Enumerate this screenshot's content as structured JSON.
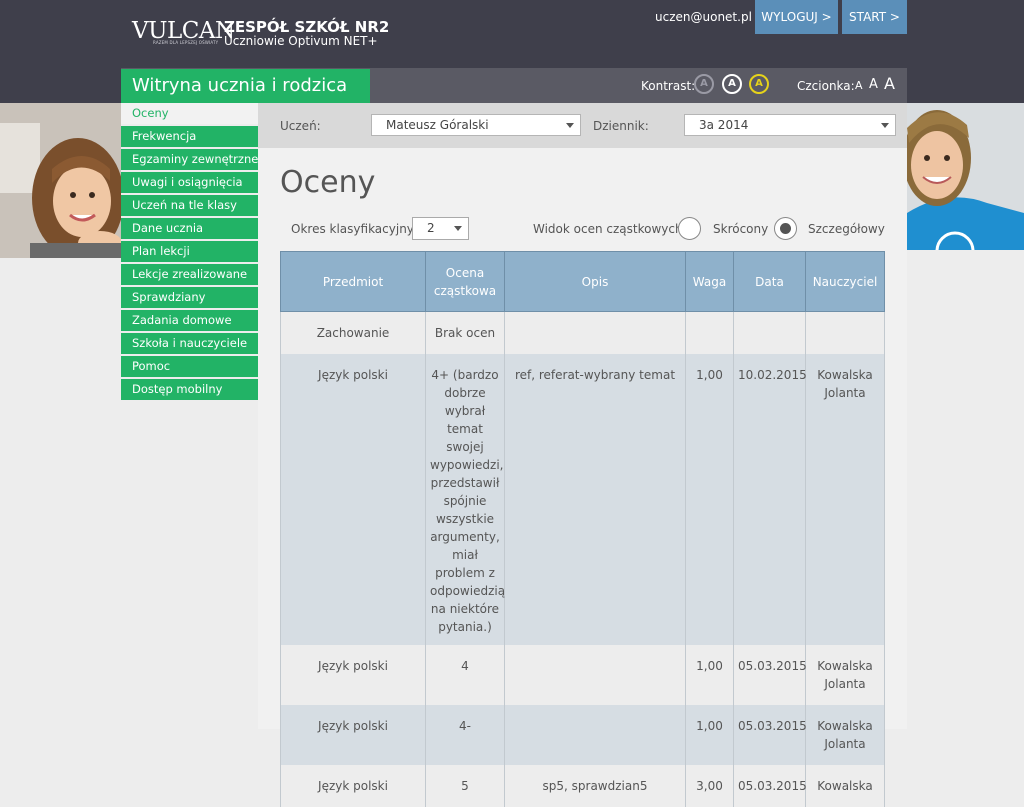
{
  "header": {
    "logo": "VULCAN",
    "logo_tagline": "RAZEM DLA LEPSZEJ OŚWIATY",
    "school_name": "ZESPÓŁ SZKÓŁ NR2",
    "school_subtitle": "Uczniowie Optivum NET+",
    "user_email": "uczen@uonet.pl",
    "logout_label": "WYLOGUJ >",
    "start_label": "START >",
    "portal_title": "Witryna ucznia i rodzica",
    "contrast_label": "Kontrast:",
    "contrast_options": [
      "A",
      "A",
      "A"
    ],
    "font_label": "Czcionka:",
    "font_sizes": [
      "A",
      "A",
      "A"
    ]
  },
  "sidebar": {
    "items": [
      {
        "label": "Oceny",
        "active": true
      },
      {
        "label": "Frekwencja"
      },
      {
        "label": "Egzaminy zewnętrzne"
      },
      {
        "label": "Uwagi i osiągnięcia"
      },
      {
        "label": "Uczeń na tle klasy"
      },
      {
        "label": "Dane ucznia"
      },
      {
        "label": "Plan lekcji"
      },
      {
        "label": "Lekcje zrealizowane"
      },
      {
        "label": "Sprawdziany"
      },
      {
        "label": "Zadania domowe"
      },
      {
        "label": "Szkoła i nauczyciele"
      },
      {
        "label": "Pomoc"
      },
      {
        "label": "Dostęp mobilny"
      }
    ]
  },
  "filters": {
    "student_label": "Uczeń:",
    "student_value": "Mateusz Góralski",
    "journal_label": "Dziennik:",
    "journal_value": "3a 2014"
  },
  "page": {
    "title": "Oceny",
    "period_label": "Okres klasyfikacyjny:",
    "period_value": "2",
    "view_label": "Widok ocen cząstkowych:",
    "view_short": "Skrócony",
    "view_detailed": "Szczegółowy",
    "selected_view": "Szczegółowy"
  },
  "table": {
    "headers": [
      "Przedmiot",
      "Ocena cząstkowa",
      "Opis",
      "Waga",
      "Data",
      "Nauczyciel"
    ],
    "rows": [
      {
        "subject": "Zachowanie",
        "grade": "Brak ocen",
        "description": "",
        "weight": "",
        "date": "",
        "teacher": ""
      },
      {
        "subject": "Język polski",
        "grade": "4+ (bardzo dobrze wybrał temat swojej wypowiedzi, przedstawił spójnie wszystkie argumenty, miał problem z odpowiedzią na niektóre pytania.)",
        "description": "ref, referat-wybrany temat",
        "weight": "1,00",
        "date": "10.02.2015",
        "teacher": "Kowalska Jolanta"
      },
      {
        "subject": "Język polski",
        "grade": "4",
        "description": "",
        "weight": "1,00",
        "date": "05.03.2015",
        "teacher": "Kowalska Jolanta"
      },
      {
        "subject": "Język polski",
        "grade": "4-",
        "description": "",
        "weight": "1,00",
        "date": "05.03.2015",
        "teacher": "Kowalska Jolanta"
      },
      {
        "subject": "Język polski",
        "grade": "5",
        "description": "sp5, sprawdzian5",
        "weight": "3,00",
        "date": "05.03.2015",
        "teacher": "Kowalska"
      }
    ]
  },
  "colors": {
    "green": "#22b366",
    "header_dark": "#3f3f4b",
    "button_blue": "#5b8fb9",
    "table_header": "#8fb1cb",
    "grade_green": "#7ac143",
    "grade_blue": "#3d86c6"
  }
}
